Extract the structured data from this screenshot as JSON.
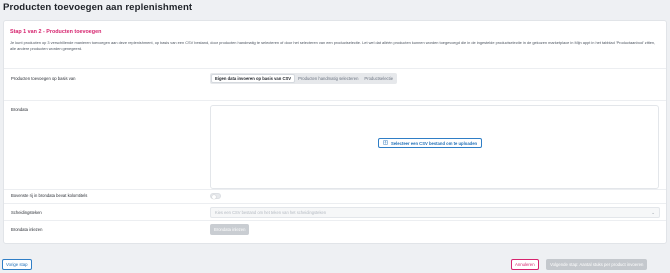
{
  "page": {
    "title": "Producten toevoegen aan replenishment"
  },
  "step": {
    "title": "Stap 1 van 2 - Producten toevoegen",
    "intro": "Je kunt producten op 3 verschillende manieren toevoegen aan deze replenishment, op basis van een CSV bestand, door producten handmatig te selecteren of door het selecteren van een productselectie. Let wel dat alléén producten kunnen worden toegevoegd die in de ingestelde productselectie in de gekozen marketplace in Mijn appt in het tabblad 'Productaanbod' zitten, alle andere producten worden genegeerd."
  },
  "method": {
    "label": "Producten toevoegen op basis van",
    "tabs": [
      {
        "label": "Eigen data invoeren op basis van CSV",
        "active": true
      },
      {
        "label": "Producten handmatig selecteren",
        "active": false
      },
      {
        "label": "Productselectie",
        "active": false
      }
    ]
  },
  "source": {
    "label": "Brondata",
    "upload_label": "Selecteer een CSV bestand om te uploaden"
  },
  "header_row": {
    "label": "Bovenste rij in brondata bevat kolomtitels",
    "enabled": false
  },
  "separator": {
    "label": "Scheidingsteken",
    "placeholder": "Kies een CSV bestand om het teken van het scheidingsteken"
  },
  "import": {
    "label": "Brondata inlezen",
    "button_label": "Brondata inlezen"
  },
  "footer": {
    "prev_label": "Vorige stap",
    "cancel_label": "Annuleren",
    "next_label": "Volgende stap: Aantal stuks per product invoeren"
  },
  "colors": {
    "accent": "#d6246e",
    "primary": "#2f7ec6",
    "disabled": "#c9cdd2"
  },
  "icons": {
    "upload": "upload-icon",
    "chevron": "chevron-down-icon"
  }
}
